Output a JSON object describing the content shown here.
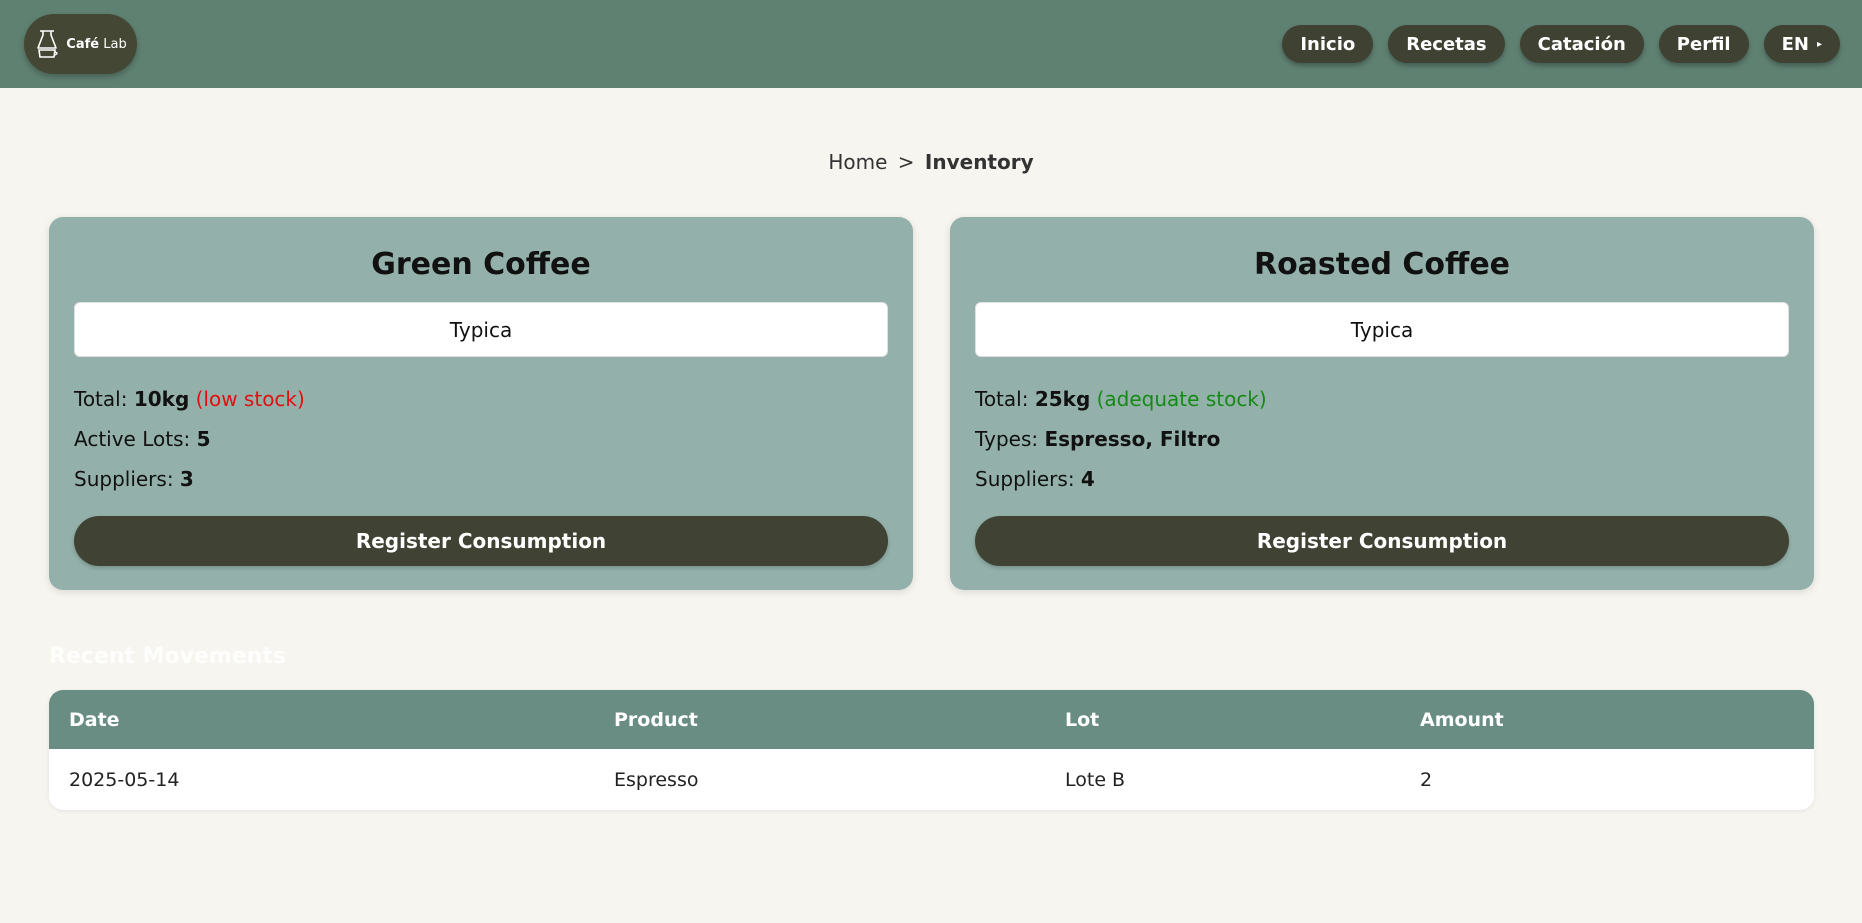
{
  "header": {
    "logo": {
      "brand_strong": "Café",
      "brand_rest": "Lab"
    },
    "nav": [
      {
        "label": "Inicio"
      },
      {
        "label": "Recetas"
      },
      {
        "label": "Catación"
      },
      {
        "label": "Perfil"
      }
    ],
    "language": {
      "label": "EN",
      "caret": "▸"
    }
  },
  "breadcrumb": {
    "home": "Home",
    "separator": ">",
    "current": "Inventory"
  },
  "cards": {
    "green": {
      "title": "Green Coffee",
      "variety": "Typica",
      "total_label": "Total:",
      "total_value": "10kg",
      "total_status": "(low stock)",
      "row2_label": "Active Lots:",
      "row2_value": "5",
      "row3_label": "Suppliers:",
      "row3_value": "3",
      "action": "Register Consumption",
      "status_color": "#e01010"
    },
    "roasted": {
      "title": "Roasted Coffee",
      "variety": "Typica",
      "total_label": "Total:",
      "total_value": "25kg",
      "total_status": "(adequate stock)",
      "row2_label": "Types:",
      "row2_value": "Espresso, Filtro",
      "row3_label": "Suppliers:",
      "row3_value": "4",
      "action": "Register Consumption",
      "status_color": "#148a14"
    }
  },
  "movements": {
    "title": "Recent Movements",
    "columns": [
      "Date",
      "Product",
      "Lot",
      "Amount"
    ],
    "rows": [
      [
        "2025-05-14",
        "Espresso",
        "Lote B",
        "2"
      ]
    ]
  },
  "colors": {
    "header_bg": "#5f8172",
    "card_bg": "#93b1aa",
    "button_dark": "#404233",
    "table_header": "#6a8d83",
    "page_bg": "#f7f5f0"
  }
}
